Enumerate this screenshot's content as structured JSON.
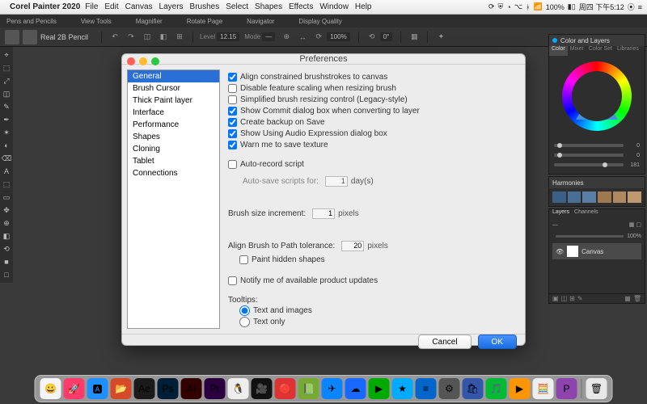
{
  "mac_menu": {
    "app_title": "Corel Painter 2020",
    "items": [
      "File",
      "Edit",
      "Canvas",
      "Layers",
      "Brushes",
      "Select",
      "Shapes",
      "Effects",
      "Window",
      "Help"
    ],
    "status_right": "周四 下午5:12",
    "battery": "100%"
  },
  "secondary_bar": {
    "groups": [
      "Pens and Pencils",
      "View Tools",
      "Magnifier",
      "Rotate Page",
      "Navigator",
      "Display Quality"
    ]
  },
  "toolbar": {
    "brush_name": "Real 2B Pencil",
    "level_label": "Level",
    "level_val": "12.15",
    "mode_label": "Mode"
  },
  "left_tool_icons": [
    "⌖",
    "⬚",
    "⤢",
    "◫",
    "✎",
    "✒",
    "✶",
    "◐",
    "⌫",
    "A",
    "⬚",
    "▭",
    "✥",
    "⊕",
    "◧",
    "⟲",
    "■",
    "□"
  ],
  "dialog": {
    "title": "Preferences",
    "categories": [
      "General",
      "Brush Cursor",
      "Thick Paint layer",
      "Interface",
      "Performance",
      "Shapes",
      "Cloning",
      "Tablet",
      "Connections"
    ],
    "selected_category": 0,
    "checks": [
      {
        "label": "Align constrained brushstrokes to canvas",
        "checked": true
      },
      {
        "label": "Disable feature scaling when resizing brush",
        "checked": false
      },
      {
        "label": "Simplified brush resizing control (Legacy-style)",
        "checked": false
      },
      {
        "label": "Show Commit dialog box when converting to layer",
        "checked": true
      },
      {
        "label": "Create backup on Save",
        "checked": true
      },
      {
        "label": "Show Using Audio Expression dialog box",
        "checked": true
      },
      {
        "label": "Warn me to save texture",
        "checked": true
      }
    ],
    "auto_record": {
      "label": "Auto-record script",
      "checked": false
    },
    "autosave_label": "Auto-save scripts for:",
    "autosave_value": "1",
    "autosave_unit": "day(s)",
    "brush_size_label": "Brush size increment:",
    "brush_size_value": "1",
    "brush_size_unit": "pixels",
    "align_tol_label": "Align Brush to Path tolerance:",
    "align_tol_value": "20",
    "align_tol_unit": "pixels",
    "paint_hidden": {
      "label": "Paint hidden shapes",
      "checked": false
    },
    "notify_updates": {
      "label": "Notify me of available product updates",
      "checked": false
    },
    "tooltips_label": "Tooltips:",
    "tooltips_options": [
      "Text and images",
      "Text only"
    ],
    "tooltips_selected": 0,
    "cancel": "Cancel",
    "ok": "OK"
  },
  "panels": {
    "color_title": "Color and Layers",
    "color_tabs": [
      "Color",
      "Mixer",
      "Color Set",
      "Libraries"
    ],
    "sliders": [
      {
        "val": "0",
        "pos": 5
      },
      {
        "val": "0",
        "pos": 5
      },
      {
        "val": "181",
        "pos": 70
      }
    ],
    "harmonies_title": "Harmonies",
    "harmony_colors": [
      "#3b5f86",
      "#4a6f96",
      "#5a7fa6",
      "#a07850",
      "#b08860",
      "#c09870"
    ],
    "layers_title": "Layers",
    "layers_tabs": [
      "Layers",
      "Channels"
    ],
    "opacity_val": "100%",
    "layer_name": "Canvas"
  },
  "dock_apps": [
    {
      "c": "#f5f5f7",
      "g": "😀"
    },
    {
      "c": "#ff3b6b",
      "g": "🚀"
    },
    {
      "c": "#1e8fff",
      "g": "🅰"
    },
    {
      "c": "#d54b2a",
      "g": "📂"
    },
    {
      "c": "#1b1b1b",
      "g": "Ae"
    },
    {
      "c": "#001e36",
      "g": "Ps"
    },
    {
      "c": "#330000",
      "g": "Ai"
    },
    {
      "c": "#2a003f",
      "g": "Pr"
    },
    {
      "c": "#eee",
      "g": "🐧"
    },
    {
      "c": "#111",
      "g": "🎥"
    },
    {
      "c": "#d33",
      "g": "🔴"
    },
    {
      "c": "#7a3",
      "g": "📗"
    },
    {
      "c": "#0a84ff",
      "g": "✈"
    },
    {
      "c": "#1769ff",
      "g": "☁"
    },
    {
      "c": "#0a0",
      "g": "▶"
    },
    {
      "c": "#0af",
      "g": "★"
    },
    {
      "c": "#06c",
      "g": "≡"
    },
    {
      "c": "#555",
      "g": "⚙"
    },
    {
      "c": "#35a",
      "g": "🛍"
    },
    {
      "c": "#0b3",
      "g": "🎵"
    },
    {
      "c": "#ff9500",
      "g": "▶"
    },
    {
      "c": "#eee",
      "g": "🧮"
    },
    {
      "c": "#8e44ad",
      "g": "P"
    }
  ]
}
